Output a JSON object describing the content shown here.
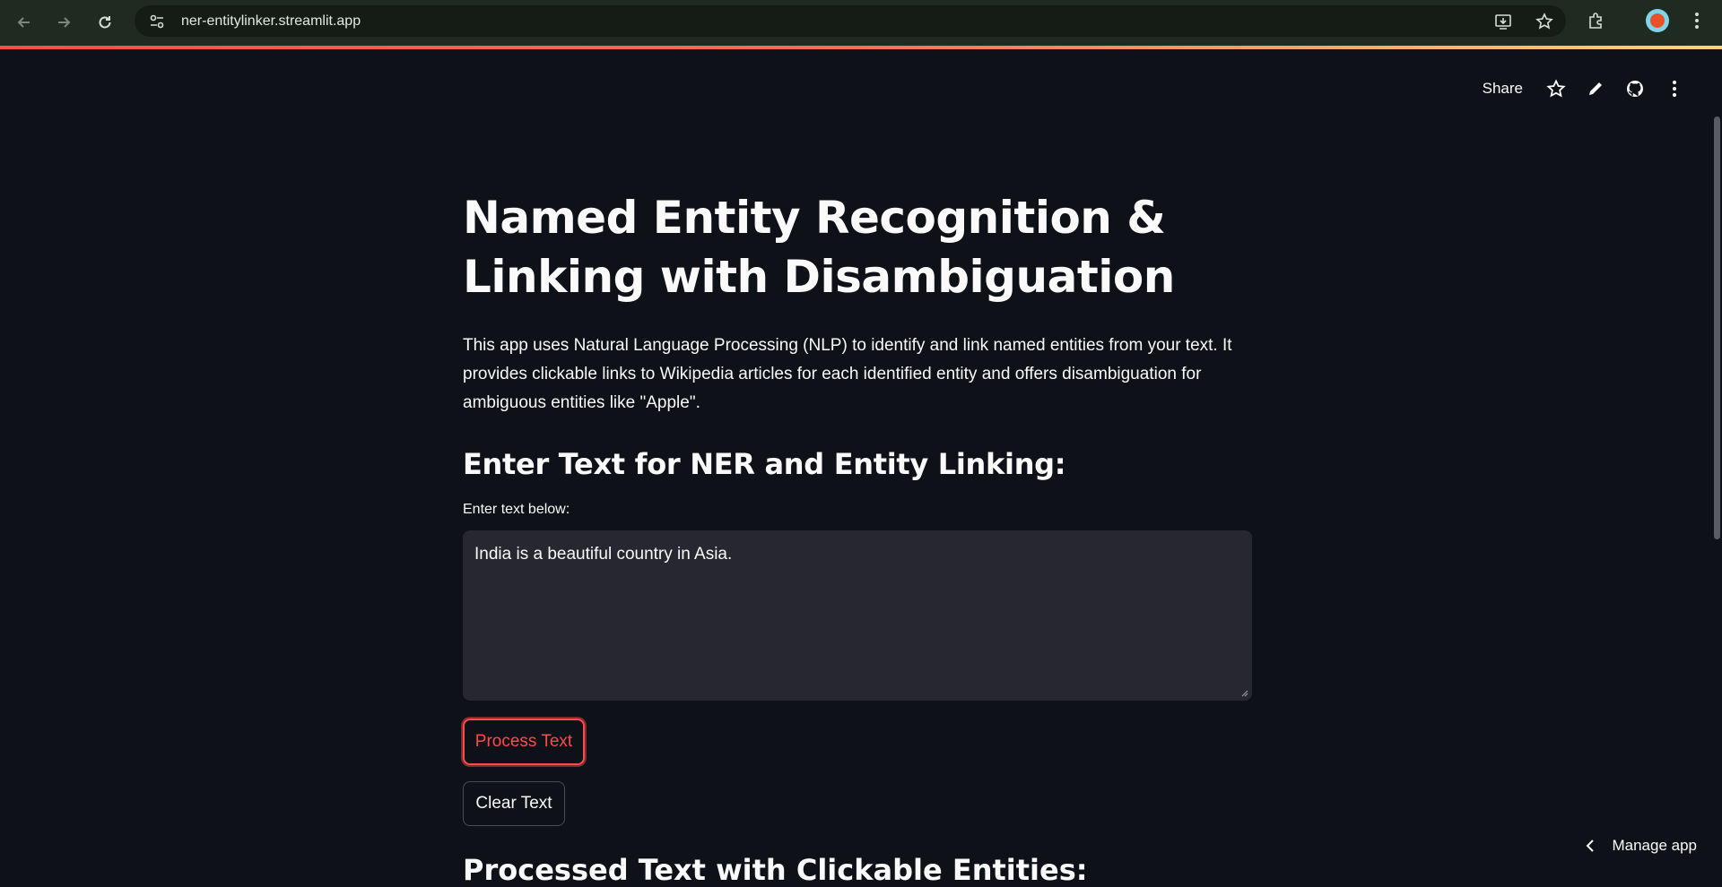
{
  "browser": {
    "url": "ner-entitylinker.streamlit.app",
    "back_icon": "arrow-left-icon",
    "forward_icon": "arrow-right-icon",
    "reload_icon": "reload-icon"
  },
  "header": {
    "share_label": "Share"
  },
  "main": {
    "title": "Named Entity Recognition & Linking with Disambiguation",
    "intro": "This app uses Natural Language Processing (NLP) to identify and link named entities from your text. It provides clickable links to Wikipedia articles for each identified entity and offers disambiguation for ambiguous entities like \"Apple\".",
    "section_heading": "Enter Text for NER and Entity Linking:",
    "input_label": "Enter text below:",
    "input_value": "India is a beautiful country in Asia.",
    "process_button": "Process Text",
    "clear_button": "Clear Text",
    "next_heading": "Processed Text with Clickable Entities:"
  },
  "footer": {
    "manage_app": "Manage app"
  },
  "colors": {
    "background": "#0e1117",
    "accent": "#ff4b4b",
    "input_bg": "#262730"
  }
}
